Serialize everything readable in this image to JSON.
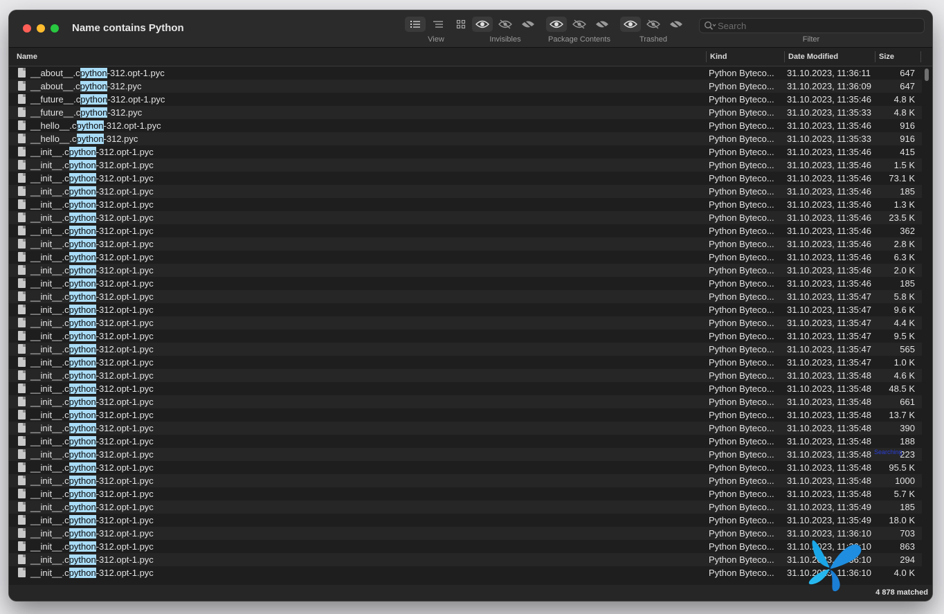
{
  "window": {
    "title": "Name contains Python"
  },
  "toolbar": {
    "view_label": "View",
    "invisibles_label": "Invisibles",
    "package_label": "Package Contents",
    "trashed_label": "Trashed",
    "filter_label": "Filter",
    "search_placeholder": "Search"
  },
  "columns": {
    "name": "Name",
    "kind": "Kind",
    "date": "Date Modified",
    "size": "Size"
  },
  "highlight": "python",
  "overlay_text": "Searching",
  "rows": [
    {
      "pre": "__about__.c",
      "post": "-312.opt-1.pyc",
      "kind": "Python Byteco...",
      "date": "31.10.2023, 11:36:11",
      "size": "647"
    },
    {
      "pre": "__about__.c",
      "post": "-312.pyc",
      "kind": "Python Byteco...",
      "date": "31.10.2023, 11:36:09",
      "size": "647"
    },
    {
      "pre": "__future__.c",
      "post": "-312.opt-1.pyc",
      "kind": "Python Byteco...",
      "date": "31.10.2023, 11:35:46",
      "size": "4.8 K"
    },
    {
      "pre": "__future__.c",
      "post": "-312.pyc",
      "kind": "Python Byteco...",
      "date": "31.10.2023, 11:35:33",
      "size": "4.8 K"
    },
    {
      "pre": "__hello__.c",
      "post": "-312.opt-1.pyc",
      "kind": "Python Byteco...",
      "date": "31.10.2023, 11:35:46",
      "size": "916"
    },
    {
      "pre": "__hello__.c",
      "post": "-312.pyc",
      "kind": "Python Byteco...",
      "date": "31.10.2023, 11:35:33",
      "size": "916"
    },
    {
      "pre": "__init__.c",
      "post": "-312.opt-1.pyc",
      "kind": "Python Byteco...",
      "date": "31.10.2023, 11:35:46",
      "size": "415"
    },
    {
      "pre": "__init__.c",
      "post": "-312.opt-1.pyc",
      "kind": "Python Byteco...",
      "date": "31.10.2023, 11:35:46",
      "size": "1.5 K"
    },
    {
      "pre": "__init__.c",
      "post": "-312.opt-1.pyc",
      "kind": "Python Byteco...",
      "date": "31.10.2023, 11:35:46",
      "size": "73.1 K"
    },
    {
      "pre": "__init__.c",
      "post": "-312.opt-1.pyc",
      "kind": "Python Byteco...",
      "date": "31.10.2023, 11:35:46",
      "size": "185"
    },
    {
      "pre": "__init__.c",
      "post": "-312.opt-1.pyc",
      "kind": "Python Byteco...",
      "date": "31.10.2023, 11:35:46",
      "size": "1.3 K"
    },
    {
      "pre": "__init__.c",
      "post": "-312.opt-1.pyc",
      "kind": "Python Byteco...",
      "date": "31.10.2023, 11:35:46",
      "size": "23.5 K"
    },
    {
      "pre": "__init__.c",
      "post": "-312.opt-1.pyc",
      "kind": "Python Byteco...",
      "date": "31.10.2023, 11:35:46",
      "size": "362"
    },
    {
      "pre": "__init__.c",
      "post": "-312.opt-1.pyc",
      "kind": "Python Byteco...",
      "date": "31.10.2023, 11:35:46",
      "size": "2.8 K"
    },
    {
      "pre": "__init__.c",
      "post": "-312.opt-1.pyc",
      "kind": "Python Byteco...",
      "date": "31.10.2023, 11:35:46",
      "size": "6.3 K"
    },
    {
      "pre": "__init__.c",
      "post": "-312.opt-1.pyc",
      "kind": "Python Byteco...",
      "date": "31.10.2023, 11:35:46",
      "size": "2.0 K"
    },
    {
      "pre": "__init__.c",
      "post": "-312.opt-1.pyc",
      "kind": "Python Byteco...",
      "date": "31.10.2023, 11:35:46",
      "size": "185"
    },
    {
      "pre": "__init__.c",
      "post": "-312.opt-1.pyc",
      "kind": "Python Byteco...",
      "date": "31.10.2023, 11:35:47",
      "size": "5.8 K"
    },
    {
      "pre": "__init__.c",
      "post": "-312.opt-1.pyc",
      "kind": "Python Byteco...",
      "date": "31.10.2023, 11:35:47",
      "size": "9.6 K"
    },
    {
      "pre": "__init__.c",
      "post": "-312.opt-1.pyc",
      "kind": "Python Byteco...",
      "date": "31.10.2023, 11:35:47",
      "size": "4.4 K"
    },
    {
      "pre": "__init__.c",
      "post": "-312.opt-1.pyc",
      "kind": "Python Byteco...",
      "date": "31.10.2023, 11:35:47",
      "size": "9.5 K"
    },
    {
      "pre": "__init__.c",
      "post": "-312.opt-1.pyc",
      "kind": "Python Byteco...",
      "date": "31.10.2023, 11:35:47",
      "size": "565"
    },
    {
      "pre": "__init__.c",
      "post": "-312.opt-1.pyc",
      "kind": "Python Byteco...",
      "date": "31.10.2023, 11:35:47",
      "size": "1.0 K"
    },
    {
      "pre": "__init__.c",
      "post": "-312.opt-1.pyc",
      "kind": "Python Byteco...",
      "date": "31.10.2023, 11:35:48",
      "size": "4.6 K"
    },
    {
      "pre": "__init__.c",
      "post": "-312.opt-1.pyc",
      "kind": "Python Byteco...",
      "date": "31.10.2023, 11:35:48",
      "size": "48.5 K"
    },
    {
      "pre": "__init__.c",
      "post": "-312.opt-1.pyc",
      "kind": "Python Byteco...",
      "date": "31.10.2023, 11:35:48",
      "size": "661"
    },
    {
      "pre": "__init__.c",
      "post": "-312.opt-1.pyc",
      "kind": "Python Byteco...",
      "date": "31.10.2023, 11:35:48",
      "size": "13.7 K"
    },
    {
      "pre": "__init__.c",
      "post": "-312.opt-1.pyc",
      "kind": "Python Byteco...",
      "date": "31.10.2023, 11:35:48",
      "size": "390"
    },
    {
      "pre": "__init__.c",
      "post": "-312.opt-1.pyc",
      "kind": "Python Byteco...",
      "date": "31.10.2023, 11:35:48",
      "size": "188"
    },
    {
      "pre": "__init__.c",
      "post": "-312.opt-1.pyc",
      "kind": "Python Byteco...",
      "date": "31.10.2023, 11:35:48",
      "size": "223"
    },
    {
      "pre": "__init__.c",
      "post": "-312.opt-1.pyc",
      "kind": "Python Byteco...",
      "date": "31.10.2023, 11:35:48",
      "size": "95.5 K"
    },
    {
      "pre": "__init__.c",
      "post": "-312.opt-1.pyc",
      "kind": "Python Byteco...",
      "date": "31.10.2023, 11:35:48",
      "size": "1000"
    },
    {
      "pre": "__init__.c",
      "post": "-312.opt-1.pyc",
      "kind": "Python Byteco...",
      "date": "31.10.2023, 11:35:48",
      "size": "5.7 K"
    },
    {
      "pre": "__init__.c",
      "post": "-312.opt-1.pyc",
      "kind": "Python Byteco...",
      "date": "31.10.2023, 11:35:49",
      "size": "185"
    },
    {
      "pre": "__init__.c",
      "post": "-312.opt-1.pyc",
      "kind": "Python Byteco...",
      "date": "31.10.2023, 11:35:49",
      "size": "18.0 K"
    },
    {
      "pre": "__init__.c",
      "post": "-312.opt-1.pyc",
      "kind": "Python Byteco...",
      "date": "31.10.2023, 11:36:10",
      "size": "703"
    },
    {
      "pre": "__init__.c",
      "post": "-312.opt-1.pyc",
      "kind": "Python Byteco...",
      "date": "31.10.2023, 11:36:10",
      "size": "863"
    },
    {
      "pre": "__init__.c",
      "post": "-312.opt-1.pyc",
      "kind": "Python Byteco...",
      "date": "31.10.2023, 11:36:10",
      "size": "294"
    },
    {
      "pre": "__init__.c",
      "post": "-312.opt-1.pyc",
      "kind": "Python Byteco...",
      "date": "31.10.2023, 11:36:10",
      "size": "4.0 K"
    }
  ],
  "status": {
    "matched": "4 878 matched"
  }
}
